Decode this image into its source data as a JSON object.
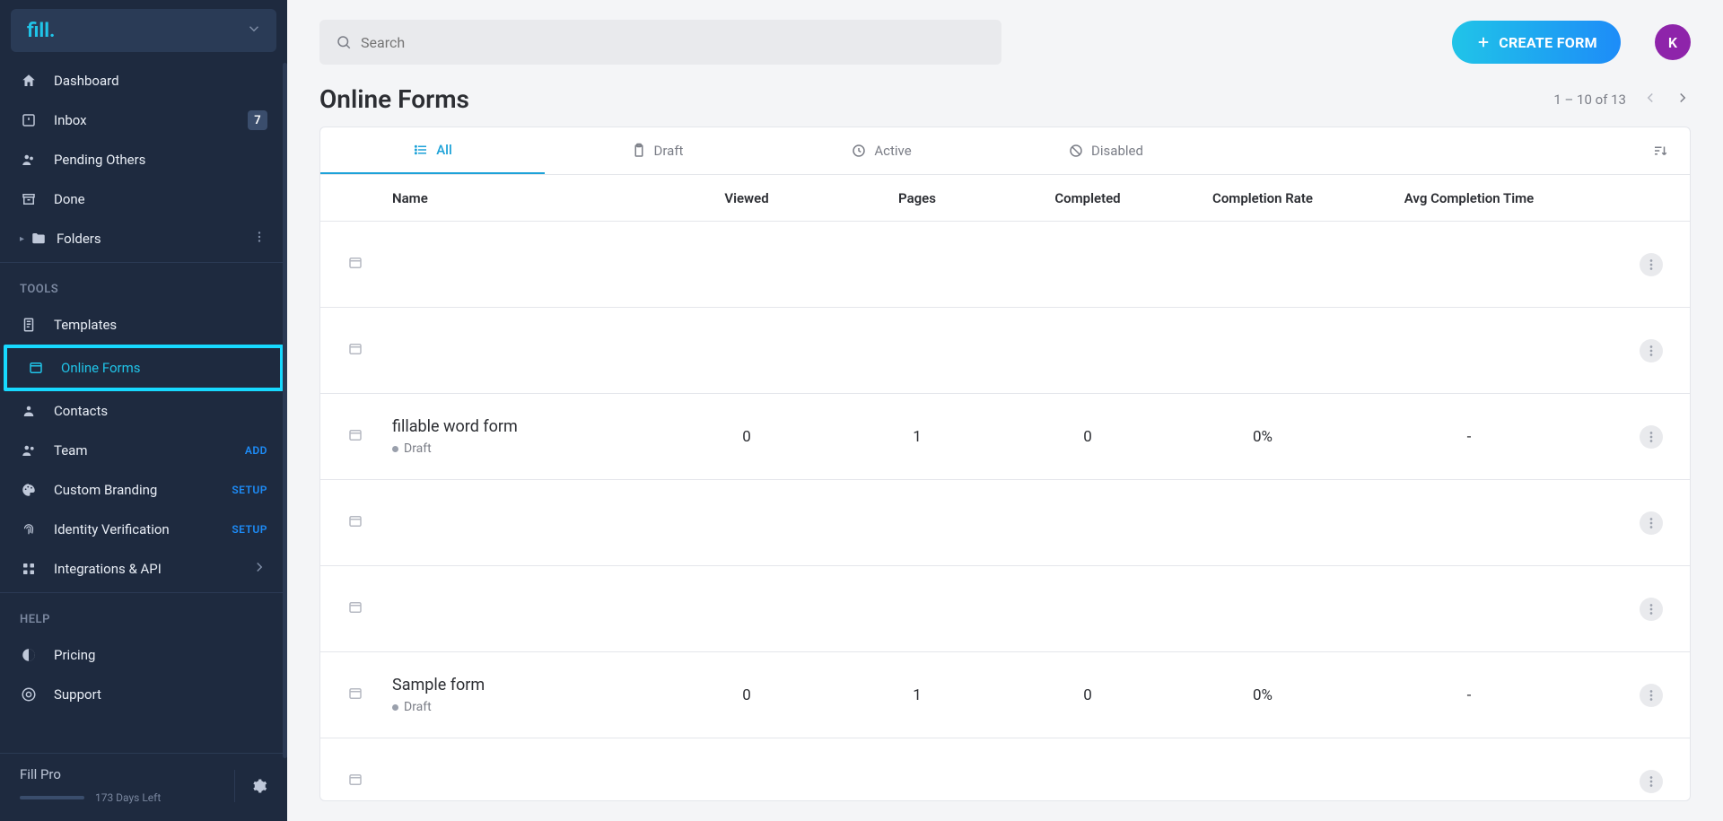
{
  "brand": "fill.",
  "sidebar": {
    "nav": [
      {
        "label": "Dashboard"
      },
      {
        "label": "Inbox",
        "badge": "7"
      },
      {
        "label": "Pending Others"
      },
      {
        "label": "Done"
      },
      {
        "label": "Folders"
      }
    ],
    "tools_label": "TOOLS",
    "tools": [
      {
        "label": "Templates"
      },
      {
        "label": "Online Forms"
      },
      {
        "label": "Contacts"
      },
      {
        "label": "Team",
        "trail": "ADD"
      },
      {
        "label": "Custom Branding",
        "trail": "SETUP"
      },
      {
        "label": "Identity Verification",
        "trail": "SETUP"
      },
      {
        "label": "Integrations & API"
      }
    ],
    "help_label": "HELP",
    "help": [
      {
        "label": "Pricing"
      },
      {
        "label": "Support"
      }
    ],
    "plan_name": "Fill Pro",
    "plan_days": "173 Days Left"
  },
  "search_placeholder": "Search",
  "create_label": "CREATE FORM",
  "avatar": "K",
  "page_title": "Online Forms",
  "pagination": "1 – 10 of 13",
  "tabs": [
    {
      "label": "All"
    },
    {
      "label": "Draft"
    },
    {
      "label": "Active"
    },
    {
      "label": "Disabled"
    }
  ],
  "columns": {
    "name": "Name",
    "viewed": "Viewed",
    "pages": "Pages",
    "completed": "Completed",
    "rate": "Completion Rate",
    "time": "Avg Completion Time"
  },
  "rows": [
    {
      "name": "",
      "status": "",
      "viewed": "",
      "pages": "",
      "completed": "",
      "rate": "",
      "time": ""
    },
    {
      "name": "",
      "status": "",
      "viewed": "",
      "pages": "",
      "completed": "",
      "rate": "",
      "time": ""
    },
    {
      "name": "fillable word form",
      "status": "Draft",
      "viewed": "0",
      "pages": "1",
      "completed": "0",
      "rate": "0%",
      "time": "-"
    },
    {
      "name": "",
      "status": "",
      "viewed": "",
      "pages": "",
      "completed": "",
      "rate": "",
      "time": ""
    },
    {
      "name": "",
      "status": "",
      "viewed": "",
      "pages": "",
      "completed": "",
      "rate": "",
      "time": ""
    },
    {
      "name": "Sample form",
      "status": "Draft",
      "viewed": "0",
      "pages": "1",
      "completed": "0",
      "rate": "0%",
      "time": "-"
    },
    {
      "name": "",
      "status": "",
      "viewed": "",
      "pages": "",
      "completed": "",
      "rate": "",
      "time": ""
    }
  ]
}
